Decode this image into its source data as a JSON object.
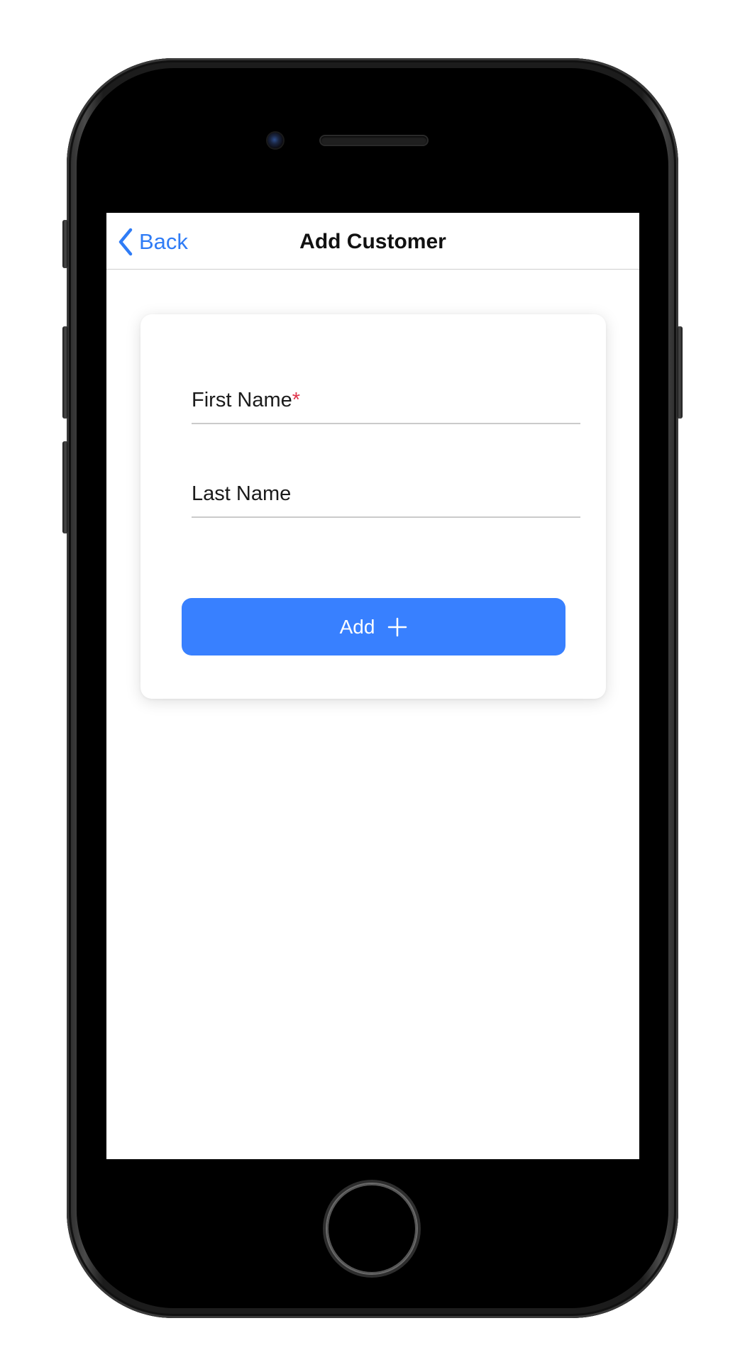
{
  "navbar": {
    "back_label": "Back",
    "title": "Add Customer"
  },
  "form": {
    "first_name": {
      "label": "First Name",
      "required_marker": "*",
      "value": ""
    },
    "last_name": {
      "label": "Last Name",
      "value": ""
    },
    "add_button_label": "Add"
  },
  "icons": {
    "back": "chevron-left-icon",
    "add": "plus-icon",
    "camera": "camera-icon",
    "home": "home-button"
  },
  "colors": {
    "accent": "#3880ff",
    "link": "#2f7cf6",
    "required": "#e0344b"
  }
}
